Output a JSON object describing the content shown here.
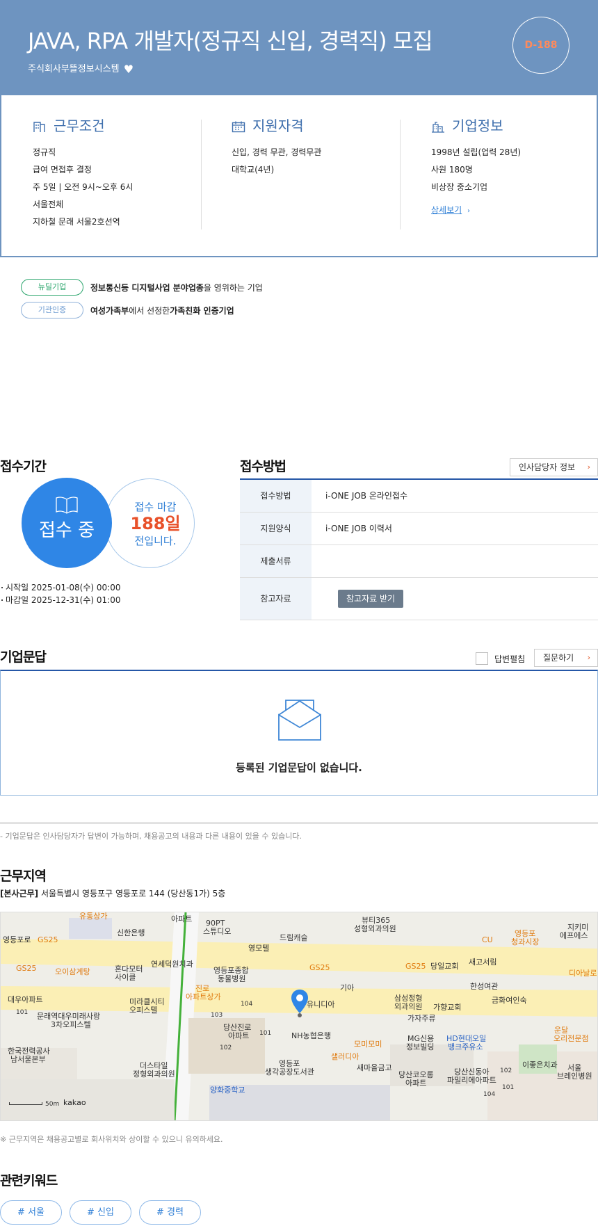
{
  "header": {
    "title": "JAVA, RPA 개발자(정규직 신입, 경력직) 모집",
    "company": "주식회사부뜰정보시스템",
    "dday": "D-188"
  },
  "work_conditions": {
    "title": "근무조건",
    "items": [
      "정규직",
      "급여 면접후 결정",
      "주 5일 | 오전 9시~오후 6시",
      "서울전체",
      "지하철 문래 서울2호선역"
    ]
  },
  "qualifications": {
    "title": "지원자격",
    "items": [
      "신입, 경력 무관, 경력무관",
      "대학교(4년)"
    ]
  },
  "company_info": {
    "title": "기업정보",
    "items": [
      "1998년 설립(업력 28년)",
      "사원 180명",
      "비상장 중소기업"
    ],
    "more_label": "상세보기"
  },
  "tags": [
    {
      "badge": "뉴딜기업",
      "text_bold": "정보통신등 디지털사업 분야업종",
      "text": "을 영위하는 기업"
    },
    {
      "badge": "기관인증",
      "text_bold": "여성가족부",
      "text": "에서 선정한 ",
      "text_bold2": "가족친화 인증기업"
    }
  ],
  "period": {
    "title": "접수기간",
    "status": "접수 중",
    "deadline_label": "접수 마감",
    "days": "188일",
    "days_suffix": "전입니다.",
    "start": "시작일 2025-01-08(수) 00:00",
    "end": "마감일 2025-12-31(수) 01:00"
  },
  "method": {
    "title": "접수방법",
    "contact_button": "인사담당자 정보",
    "rows": [
      {
        "key": "접수방법",
        "value": "i-ONE JOB 온라인접수"
      },
      {
        "key": "지원양식",
        "value": "i-ONE JOB 이력서"
      },
      {
        "key": "제출서류",
        "value": ""
      },
      {
        "key": "참고자료",
        "button": "참고자료 받기"
      }
    ]
  },
  "qa": {
    "title": "기업문답",
    "toggle_label": "답변펼침",
    "ask_button": "질문하기",
    "empty": "등록된 기업문답이 없습니다.",
    "note": "- 기업문답은 인사담당자가 답변이 가능하며, 채용공고의 내용과 다른 내용이 있을 수 있습니다."
  },
  "location": {
    "title": "근무지역",
    "branch": "[본사근무]",
    "address": "서울특별시 영등포구 영등포로 144 (당산동1가) 5층",
    "note": "※ 근무지역은 채용공고별로 회사위치와 상이할 수 있으니 유의하세요.",
    "scale": "50m",
    "map_brand": "kakao"
  },
  "map_labels": {
    "l1": "유통상가",
    "l2": "아파트",
    "l3": "90PT",
    "l4": "스튜디오",
    "l5": "뷰티365",
    "l6": "성형외과의원",
    "l7": "영등포",
    "l8": "청과시장",
    "l9": "지키미",
    "l10": "에프에스",
    "l11": "영등포로",
    "l12": "GS25",
    "l13": "신한은행",
    "l14": "드림캐슬",
    "l15": "영모텔",
    "l16": "CU",
    "l17": "GS25",
    "l18": "오이삼계탕",
    "l19": "혼다모터",
    "l20": "사이클",
    "l21": "연세덕원치과",
    "l22": "영등포종합",
    "l23": "동물병원",
    "l24": "GS25",
    "l25": "GS25",
    "l26": "당일교회",
    "l27": "새고서림",
    "l28": "디아날로",
    "l29": "대우아파트",
    "l30": "미라클시티",
    "l31": "오피스텔",
    "l32": "진로",
    "l33": "아파트상가",
    "l34": "기아",
    "l35": "삼성정형",
    "l36": "외과의원",
    "l37": "가향교회",
    "l38": "한성여관",
    "l39": "금화여인숙",
    "l40": "문래역대우미래사랑",
    "l41": "3차오피스텔",
    "l42": "당산진로",
    "l43": "아파트",
    "l44": "유니디아",
    "l45": "가자주류",
    "l46": "한국전력공사",
    "l47": "남서울본부",
    "l48": "NH농협은행",
    "l49": "모미모미",
    "l50": "MG신용",
    "l51": "정보빌딩",
    "l52": "HD현대오일",
    "l53": "뱅크주유소",
    "l54": "운달",
    "l55": "오리전문점",
    "l56": "더스타일",
    "l57": "정형외과의원",
    "l58": "영등포",
    "l59": "생각공장도서관",
    "l60": "샐러디아",
    "l61": "새마을금고",
    "l62": "당산코오롱",
    "l63": "아파트",
    "l64": "당산신동아",
    "l65": "파밀리에아파트",
    "l66": "이좋은치과",
    "l67": "서울",
    "l68": "브레인병원",
    "l69": "양화중학교",
    "n101": "101",
    "n102": "102",
    "n103": "103",
    "n104": "104",
    "n101b": "101",
    "n102b": "102",
    "n104b": "104",
    "n101c": "101"
  },
  "keywords": {
    "title": "관련키워드",
    "items": [
      "# 서울",
      "# 신입",
      "# 경력"
    ]
  },
  "colors": {
    "header_bg": "#6e94c0",
    "accent_blue": "#2f86e6",
    "dday_orange": "#ff8a5b",
    "days_red": "#e8512a"
  }
}
